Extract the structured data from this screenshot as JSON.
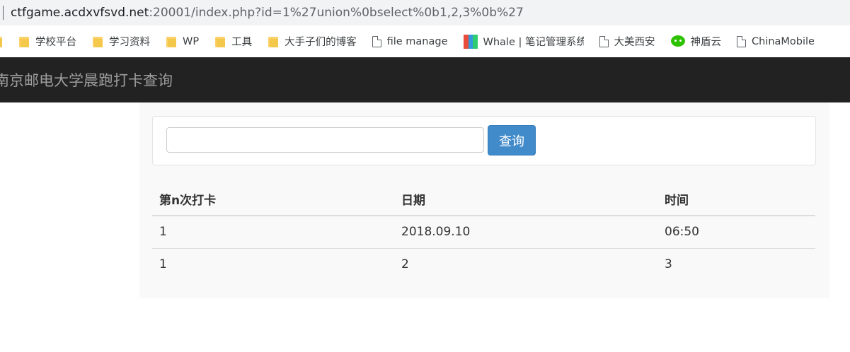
{
  "browser": {
    "url_host": "ctfgame.acdxvfsvd.net",
    "url_path": ":20001/index.php?id=1%27union%0bselect%0b1,2,3%0b%27",
    "bookmarks": [
      {
        "label": "",
        "icon": "folder-icon"
      },
      {
        "label": "学校平台",
        "icon": "folder-icon"
      },
      {
        "label": "学习资料",
        "icon": "folder-icon"
      },
      {
        "label": "WP",
        "icon": "folder-icon"
      },
      {
        "label": "工具",
        "icon": "folder-icon"
      },
      {
        "label": "大手子们的博客",
        "icon": "folder-icon"
      },
      {
        "label": "file manage",
        "icon": "page-icon"
      },
      {
        "label": "Whale | 笔记管理系统",
        "icon": "whale-icon"
      },
      {
        "label": "大美西安",
        "icon": "page-icon"
      },
      {
        "label": "神盾云",
        "icon": "wechat-icon"
      },
      {
        "label": "ChinaMobile",
        "icon": "page-icon"
      }
    ]
  },
  "navbar": {
    "brand": "南京邮电大学晨跑打卡查询"
  },
  "search": {
    "input_value": "",
    "input_placeholder": "",
    "button_label": "查询",
    "button_color": "#428bca"
  },
  "table": {
    "headers": [
      "第n次打卡",
      "日期",
      "时间"
    ],
    "rows": [
      [
        "1",
        "2018.09.10",
        "06:50"
      ],
      [
        "1",
        "2",
        "3"
      ]
    ]
  }
}
